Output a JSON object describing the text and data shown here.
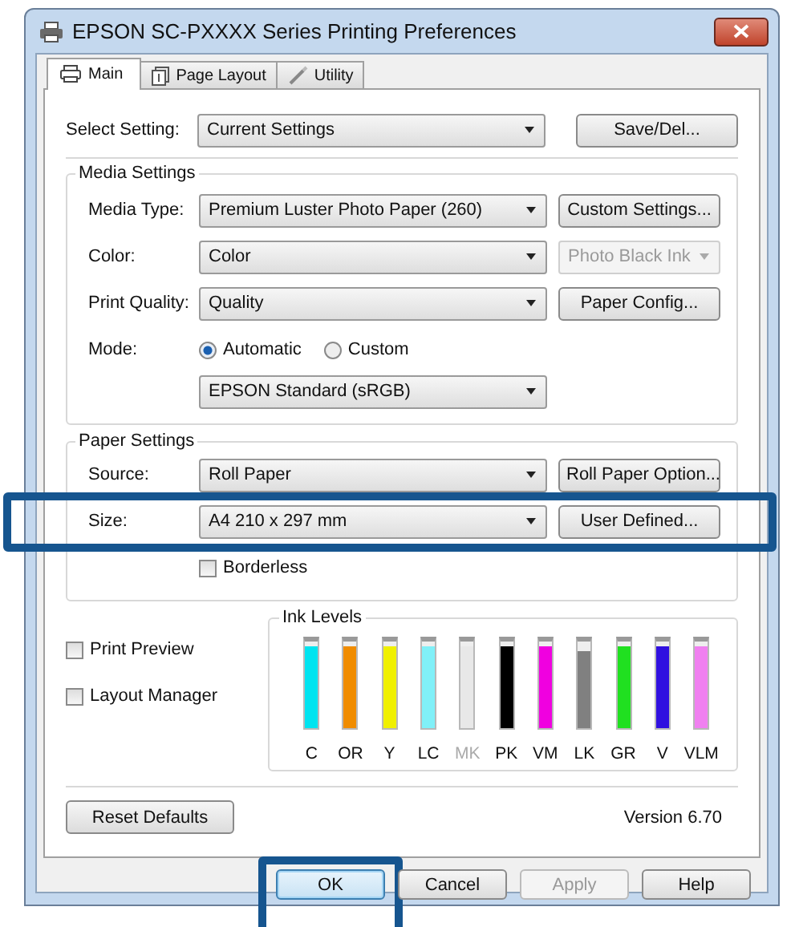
{
  "window": {
    "title": "EPSON SC-PXXXX Series Printing Preferences"
  },
  "tabs": [
    {
      "label": "Main",
      "selected": true
    },
    {
      "label": "Page Layout",
      "selected": false
    },
    {
      "label": "Utility",
      "selected": false
    }
  ],
  "select_setting": {
    "label": "Select Setting:",
    "value": "Current Settings",
    "button": "Save/Del..."
  },
  "media_settings": {
    "title": "Media Settings",
    "rows": [
      {
        "label": "Media Type:",
        "value": "Premium Luster Photo Paper (260)",
        "side": {
          "kind": "button",
          "label": "Custom Settings...",
          "disabled": false
        }
      },
      {
        "label": "Color:",
        "value": "Color",
        "side": {
          "kind": "combo",
          "label": "Photo Black Ink",
          "disabled": true
        }
      },
      {
        "label": "Print Quality:",
        "value": "Quality",
        "side": {
          "kind": "button",
          "label": "Paper Config...",
          "disabled": false
        }
      }
    ],
    "mode": {
      "label": "Mode:",
      "options": [
        {
          "label": "Automatic",
          "selected": true
        },
        {
          "label": "Custom",
          "selected": false
        }
      ],
      "value": "EPSON Standard (sRGB)"
    }
  },
  "paper_settings": {
    "title": "Paper Settings",
    "rows": [
      {
        "label": "Source:",
        "value": "Roll Paper",
        "side": {
          "label": "Roll Paper Option...",
          "disabled": false
        },
        "highlighted": false
      },
      {
        "label": "Size:",
        "value": "A4 210 x 297 mm",
        "side": {
          "label": "User Defined...",
          "disabled": false
        },
        "highlighted": true
      }
    ],
    "borderless": {
      "label": "Borderless",
      "checked": false
    }
  },
  "options": [
    {
      "label": "Print Preview",
      "checked": false
    },
    {
      "label": "Layout Manager",
      "checked": false
    }
  ],
  "ink_levels": {
    "title": "Ink Levels",
    "inks": [
      {
        "label": "C",
        "color": "#00e4f0",
        "level": 0.95,
        "disabled": false
      },
      {
        "label": "OR",
        "color": "#f08c00",
        "level": 0.95,
        "disabled": false
      },
      {
        "label": "Y",
        "color": "#f0f000",
        "level": 0.95,
        "disabled": false
      },
      {
        "label": "LC",
        "color": "#80f0f8",
        "level": 0.95,
        "disabled": false
      },
      {
        "label": "MK",
        "color": "#e8e8e8",
        "level": 0.95,
        "disabled": true
      },
      {
        "label": "PK",
        "color": "#000000",
        "level": 0.95,
        "disabled": false
      },
      {
        "label": "VM",
        "color": "#f000e0",
        "level": 0.95,
        "disabled": false
      },
      {
        "label": "LK",
        "color": "#808080",
        "level": 0.88,
        "disabled": false
      },
      {
        "label": "GR",
        "color": "#20e020",
        "level": 0.95,
        "disabled": false
      },
      {
        "label": "V",
        "color": "#3010e0",
        "level": 0.95,
        "disabled": false
      },
      {
        "label": "VLM",
        "color": "#f080f0",
        "level": 0.95,
        "disabled": false
      }
    ]
  },
  "reset_button": "Reset Defaults",
  "version": "Version 6.70",
  "buttons": [
    {
      "label": "OK",
      "default": true,
      "disabled": false,
      "highlighted": true
    },
    {
      "label": "Cancel",
      "default": false,
      "disabled": false,
      "highlighted": false
    },
    {
      "label": "Apply",
      "default": false,
      "disabled": true,
      "highlighted": false
    },
    {
      "label": "Help",
      "default": false,
      "disabled": false,
      "highlighted": false
    }
  ]
}
